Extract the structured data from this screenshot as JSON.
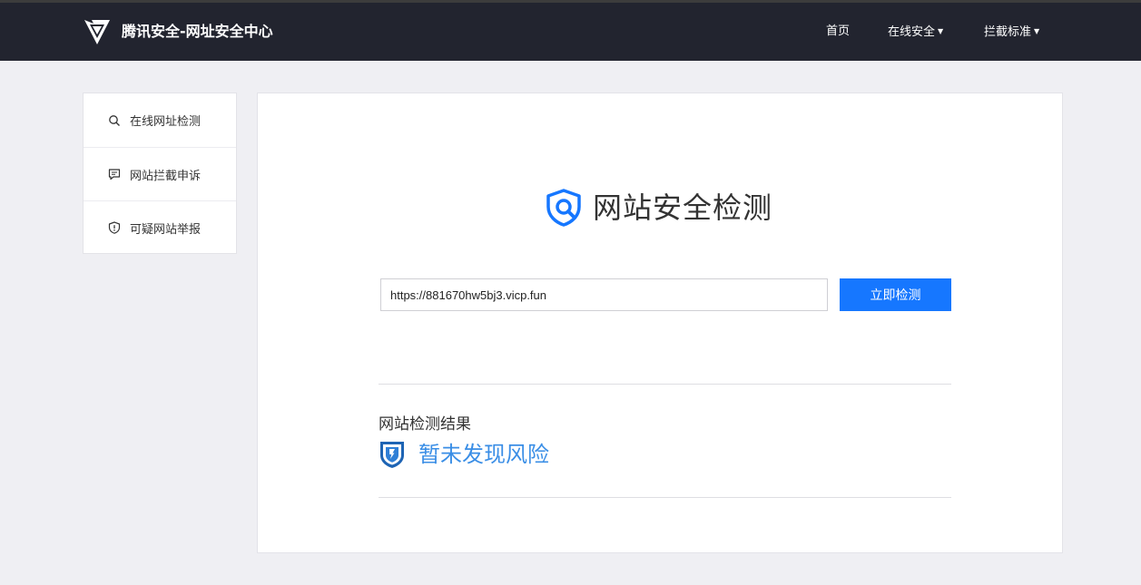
{
  "header": {
    "site_title": "腾讯安全-网址安全中心",
    "nav": [
      {
        "label": "首页",
        "has_caret": false
      },
      {
        "label": "在线安全",
        "has_caret": true
      },
      {
        "label": "拦截标准",
        "has_caret": true
      }
    ],
    "caret_glyph": "▼"
  },
  "sidebar": {
    "items": [
      {
        "label": "在线网址检测",
        "icon": "search-icon"
      },
      {
        "label": "网站拦截申诉",
        "icon": "message-icon"
      },
      {
        "label": "可疑网站举报",
        "icon": "shield-alert-icon"
      }
    ]
  },
  "main": {
    "title": "网站安全检测",
    "url_value": "https://881670hw5bj3.vicp.fun",
    "check_button": "立即检测",
    "result_label": "网站检测结果",
    "result_text": "暂未发现风险"
  },
  "colors": {
    "header_bg": "#22242f",
    "accent": "#1677ff",
    "result_blue": "#3a8ee6"
  }
}
